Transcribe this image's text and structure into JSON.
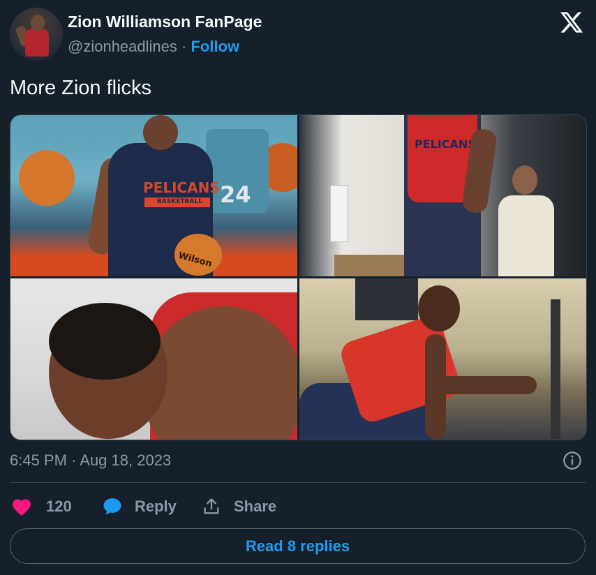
{
  "author": {
    "display_name": "Zion Williamson FanPage",
    "handle": "@zionheadlines",
    "separator": "·",
    "follow_label": "Follow"
  },
  "tweet": {
    "text": "More Zion flicks",
    "timestamp": "6:45 PM · Aug 18, 2023"
  },
  "media": {
    "photo_count": 4,
    "photo1_jersey": "PELICANS",
    "photo1_jersey_sub": "BASKETBALL",
    "photo1_ball": "Wilson",
    "photo1_banner_number": "24",
    "photo2_jersey": "PELICANS"
  },
  "actions": {
    "like_count": "120",
    "reply_label": "Reply",
    "share_label": "Share"
  },
  "read_replies_label": "Read 8 replies",
  "colors": {
    "background": "#15202b",
    "text": "#f7f9f9",
    "muted": "#8b98a5",
    "accent": "#1d9bf0",
    "heart": "#f91880",
    "border": "#38444d"
  },
  "icons": [
    "x-logo-icon",
    "info-icon",
    "heart-icon",
    "reply-bubble-icon",
    "share-icon"
  ]
}
